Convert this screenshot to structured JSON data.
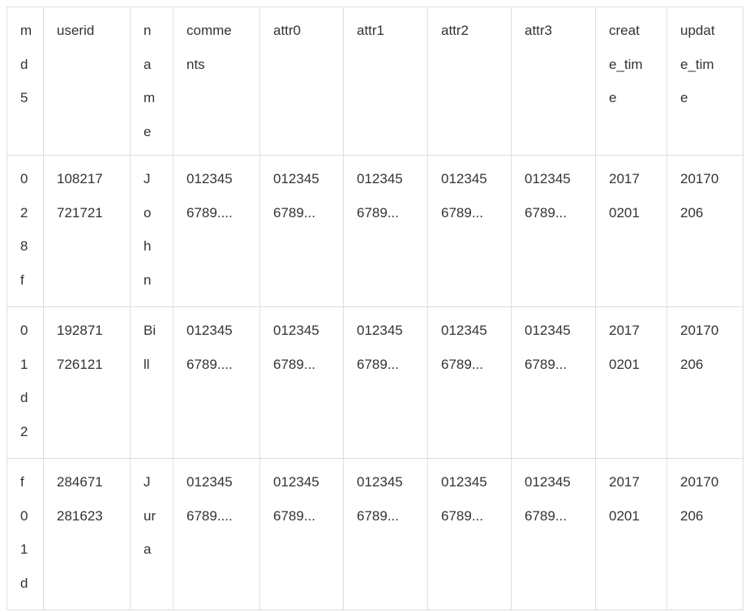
{
  "table": {
    "columns": [
      {
        "key": "md5",
        "lines": [
          "m",
          "d",
          "5"
        ]
      },
      {
        "key": "userid",
        "lines": [
          "userid"
        ]
      },
      {
        "key": "name",
        "lines": [
          "n",
          "a",
          "m",
          "e"
        ]
      },
      {
        "key": "comments",
        "lines": [
          "comme",
          "nts"
        ]
      },
      {
        "key": "attr0",
        "lines": [
          "attr0"
        ]
      },
      {
        "key": "attr1",
        "lines": [
          "attr1"
        ]
      },
      {
        "key": "attr2",
        "lines": [
          "attr2"
        ]
      },
      {
        "key": "attr3",
        "lines": [
          "attr3"
        ]
      },
      {
        "key": "create_time",
        "lines": [
          "creat",
          "e_tim",
          "e"
        ]
      },
      {
        "key": "update_time",
        "lines": [
          "updat",
          "e_tim",
          "e"
        ]
      }
    ],
    "rows": [
      {
        "cells": [
          [
            "0",
            "2",
            "8",
            "f"
          ],
          [
            "108217",
            "721721"
          ],
          [
            "J",
            "o",
            "h",
            "n"
          ],
          [
            "012345",
            "6789...."
          ],
          [
            "012345",
            "6789..."
          ],
          [
            "012345",
            "6789..."
          ],
          [
            "012345",
            "6789..."
          ],
          [
            "012345",
            "6789..."
          ],
          [
            "2017",
            "0201"
          ],
          [
            "20170",
            "206"
          ]
        ]
      },
      {
        "cells": [
          [
            "0",
            "1",
            "d",
            "2"
          ],
          [
            "192871",
            "726121"
          ],
          [
            "Bi",
            "ll"
          ],
          [
            "012345",
            "6789...."
          ],
          [
            "012345",
            "6789..."
          ],
          [
            "012345",
            "6789..."
          ],
          [
            "012345",
            "6789..."
          ],
          [
            "012345",
            "6789..."
          ],
          [
            "2017",
            "0201"
          ],
          [
            "20170",
            "206"
          ]
        ]
      },
      {
        "cells": [
          [
            "f",
            "0",
            "1",
            "d"
          ],
          [
            "284671",
            "281623"
          ],
          [
            "J",
            "ur",
            "a"
          ],
          [
            "012345",
            "6789...."
          ],
          [
            "012345",
            "6789..."
          ],
          [
            "012345",
            "6789..."
          ],
          [
            "012345",
            "6789..."
          ],
          [
            "012345",
            "6789..."
          ],
          [
            "2017",
            "0201"
          ],
          [
            "20170",
            "206"
          ]
        ]
      }
    ]
  }
}
